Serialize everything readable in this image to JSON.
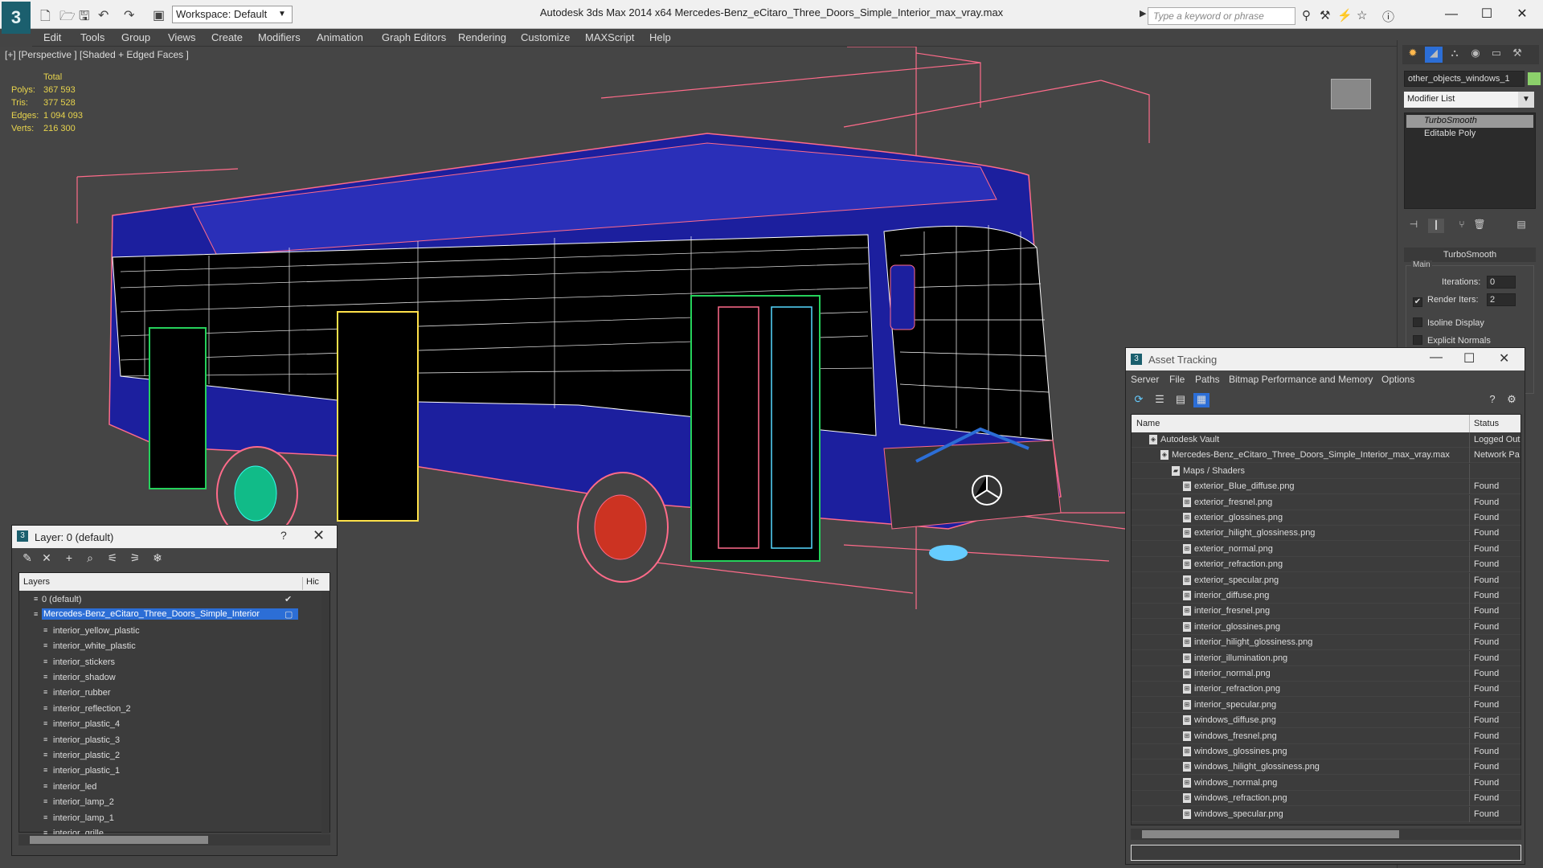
{
  "app": {
    "title": "Autodesk 3ds Max  2014 x64      Mercedes-Benz_eCitaro_Three_Doors_Simple_Interior_max_vray.max",
    "logo": "3",
    "workspace": "Workspace: Default",
    "search_placeholder": "Type a keyword or phrase"
  },
  "menu": [
    "Edit",
    "Tools",
    "Group",
    "Views",
    "Create",
    "Modifiers",
    "Animation",
    "Graph Editors",
    "Rendering",
    "Customize",
    "MAXScript",
    "Help"
  ],
  "viewport": {
    "label": "[+] [Perspective ] [Shaded + Edged Faces ]",
    "stats": {
      "total_label": "Total",
      "rows": [
        {
          "k": "Polys:",
          "v": "367 593"
        },
        {
          "k": "Tris:",
          "v": "377 528"
        },
        {
          "k": "Edges:",
          "v": "1 094 093"
        },
        {
          "k": "Verts:",
          "v": "216 300"
        }
      ]
    }
  },
  "command_panel": {
    "object_name": "other_objects_windows_1",
    "modifier_list": "Modifier List",
    "stack": [
      "TurboSmooth",
      "Editable Poly"
    ],
    "rollout": "TurboSmooth",
    "group": "Main",
    "iterations_label": "Iterations:",
    "iterations_value": "0",
    "render_iters_label": "Render Iters:",
    "render_iters_value": "2",
    "isoline": "Isoline Display",
    "explicit_normals": "Explicit Normals"
  },
  "layer_window": {
    "title": "Layer: 0 (default)",
    "help": "?",
    "col_layers": "Layers",
    "col_hide": "Hic",
    "rows": [
      {
        "label": "0 (default)",
        "indent": 0,
        "check": "✔"
      },
      {
        "label": "Mercedes-Benz_eCitaro_Three_Doors_Simple_Interior",
        "indent": 0,
        "sel": true,
        "check": "▢"
      },
      {
        "label": "interior_yellow_plastic",
        "indent": 1
      },
      {
        "label": "interior_white_plastic",
        "indent": 1
      },
      {
        "label": "interior_stickers",
        "indent": 1
      },
      {
        "label": "interior_shadow",
        "indent": 1
      },
      {
        "label": "interior_rubber",
        "indent": 1
      },
      {
        "label": "interior_reflection_2",
        "indent": 1
      },
      {
        "label": "interior_plastic_4",
        "indent": 1
      },
      {
        "label": "interior_plastic_3",
        "indent": 1
      },
      {
        "label": "interior_plastic_2",
        "indent": 1
      },
      {
        "label": "interior_plastic_1",
        "indent": 1
      },
      {
        "label": "interior_led",
        "indent": 1
      },
      {
        "label": "interior_lamp_2",
        "indent": 1
      },
      {
        "label": "interior_lamp_1",
        "indent": 1
      },
      {
        "label": "interior_grille",
        "indent": 1
      }
    ]
  },
  "asset_window": {
    "title": "Asset Tracking",
    "menu": [
      "Server",
      "File",
      "Paths",
      "Bitmap Performance and Memory",
      "Options"
    ],
    "col_name": "Name",
    "col_status": "Status",
    "rows": [
      {
        "name": "Autodesk Vault",
        "status": "Logged Out",
        "indent": 0
      },
      {
        "name": "Mercedes-Benz_eCitaro_Three_Doors_Simple_Interior_max_vray.max",
        "status": "Network Pa",
        "indent": 1
      },
      {
        "name": "Maps / Shaders",
        "status": "",
        "indent": 2
      },
      {
        "name": "exterior_Blue_diffuse.png",
        "status": "Found",
        "indent": 3
      },
      {
        "name": "exterior_fresnel.png",
        "status": "Found",
        "indent": 3
      },
      {
        "name": "exterior_glossines.png",
        "status": "Found",
        "indent": 3
      },
      {
        "name": "exterior_hilight_glossiness.png",
        "status": "Found",
        "indent": 3
      },
      {
        "name": "exterior_normal.png",
        "status": "Found",
        "indent": 3
      },
      {
        "name": "exterior_refraction.png",
        "status": "Found",
        "indent": 3
      },
      {
        "name": "exterior_specular.png",
        "status": "Found",
        "indent": 3
      },
      {
        "name": "interior_diffuse.png",
        "status": "Found",
        "indent": 3
      },
      {
        "name": "interior_fresnel.png",
        "status": "Found",
        "indent": 3
      },
      {
        "name": "interior_glossines.png",
        "status": "Found",
        "indent": 3
      },
      {
        "name": "interior_hilight_glossiness.png",
        "status": "Found",
        "indent": 3
      },
      {
        "name": "interior_illumination.png",
        "status": "Found",
        "indent": 3
      },
      {
        "name": "interior_normal.png",
        "status": "Found",
        "indent": 3
      },
      {
        "name": "interior_refraction.png",
        "status": "Found",
        "indent": 3
      },
      {
        "name": "interior_specular.png",
        "status": "Found",
        "indent": 3
      },
      {
        "name": "windows_diffuse.png",
        "status": "Found",
        "indent": 3
      },
      {
        "name": "windows_fresnel.png",
        "status": "Found",
        "indent": 3
      },
      {
        "name": "windows_glossines.png",
        "status": "Found",
        "indent": 3
      },
      {
        "name": "windows_hilight_glossiness.png",
        "status": "Found",
        "indent": 3
      },
      {
        "name": "windows_normal.png",
        "status": "Found",
        "indent": 3
      },
      {
        "name": "windows_refraction.png",
        "status": "Found",
        "indent": 3
      },
      {
        "name": "windows_specular.png",
        "status": "Found",
        "indent": 3
      }
    ]
  },
  "colors": {
    "accent": "#2c6ed6",
    "stats": "#e8d44d",
    "bus_blue": "#1c1f9e",
    "wire": "#ff6b8a"
  }
}
